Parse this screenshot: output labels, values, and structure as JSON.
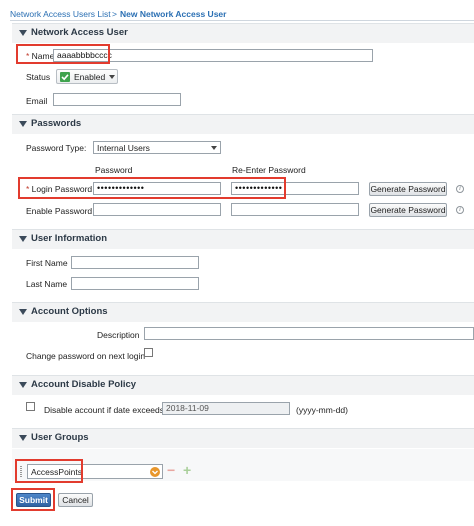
{
  "breadcrumb": {
    "parent": "Network Access Users List",
    "separator": ">",
    "current": "New Network Access User"
  },
  "network_access_user": {
    "section_title": "Network Access User",
    "name_label": "Name",
    "name_value": "aaaabbbbcccc",
    "status_label": "Status",
    "status_value": "Enabled",
    "email_label": "Email",
    "email_value": ""
  },
  "passwords": {
    "section_title": "Passwords",
    "type_label": "Password Type:",
    "type_value": "Internal Users",
    "col_password": "Password",
    "col_reenter": "Re-Enter Password",
    "login_label": "Login Password",
    "login_value": "•••••••••••••",
    "login_reenter_value": "•••••••••••••",
    "enable_label": "Enable Password",
    "generate_label": "Generate Password",
    "info_glyph": "i"
  },
  "user_information": {
    "section_title": "User Information",
    "first_name_label": "First Name",
    "last_name_label": "Last Name"
  },
  "account_options": {
    "section_title": "Account Options",
    "description_label": "Description",
    "change_password_label": "Change password on next login"
  },
  "account_disable": {
    "section_title": "Account Disable Policy",
    "disable_label": "Disable account if date exceeds",
    "date_value": "2018-11-09",
    "date_hint": "(yyyy-mm-dd)"
  },
  "user_groups": {
    "section_title": "User Groups",
    "group_value": "AccessPoints",
    "remove_glyph": "−",
    "add_glyph": "+"
  },
  "actions": {
    "submit": "Submit",
    "cancel": "Cancel"
  },
  "colors": {
    "accent_blue": "#2a6fb3",
    "highlight_red": "#e23b2e",
    "status_green": "#3fa34d",
    "dropdown_orange": "#e8962b"
  }
}
